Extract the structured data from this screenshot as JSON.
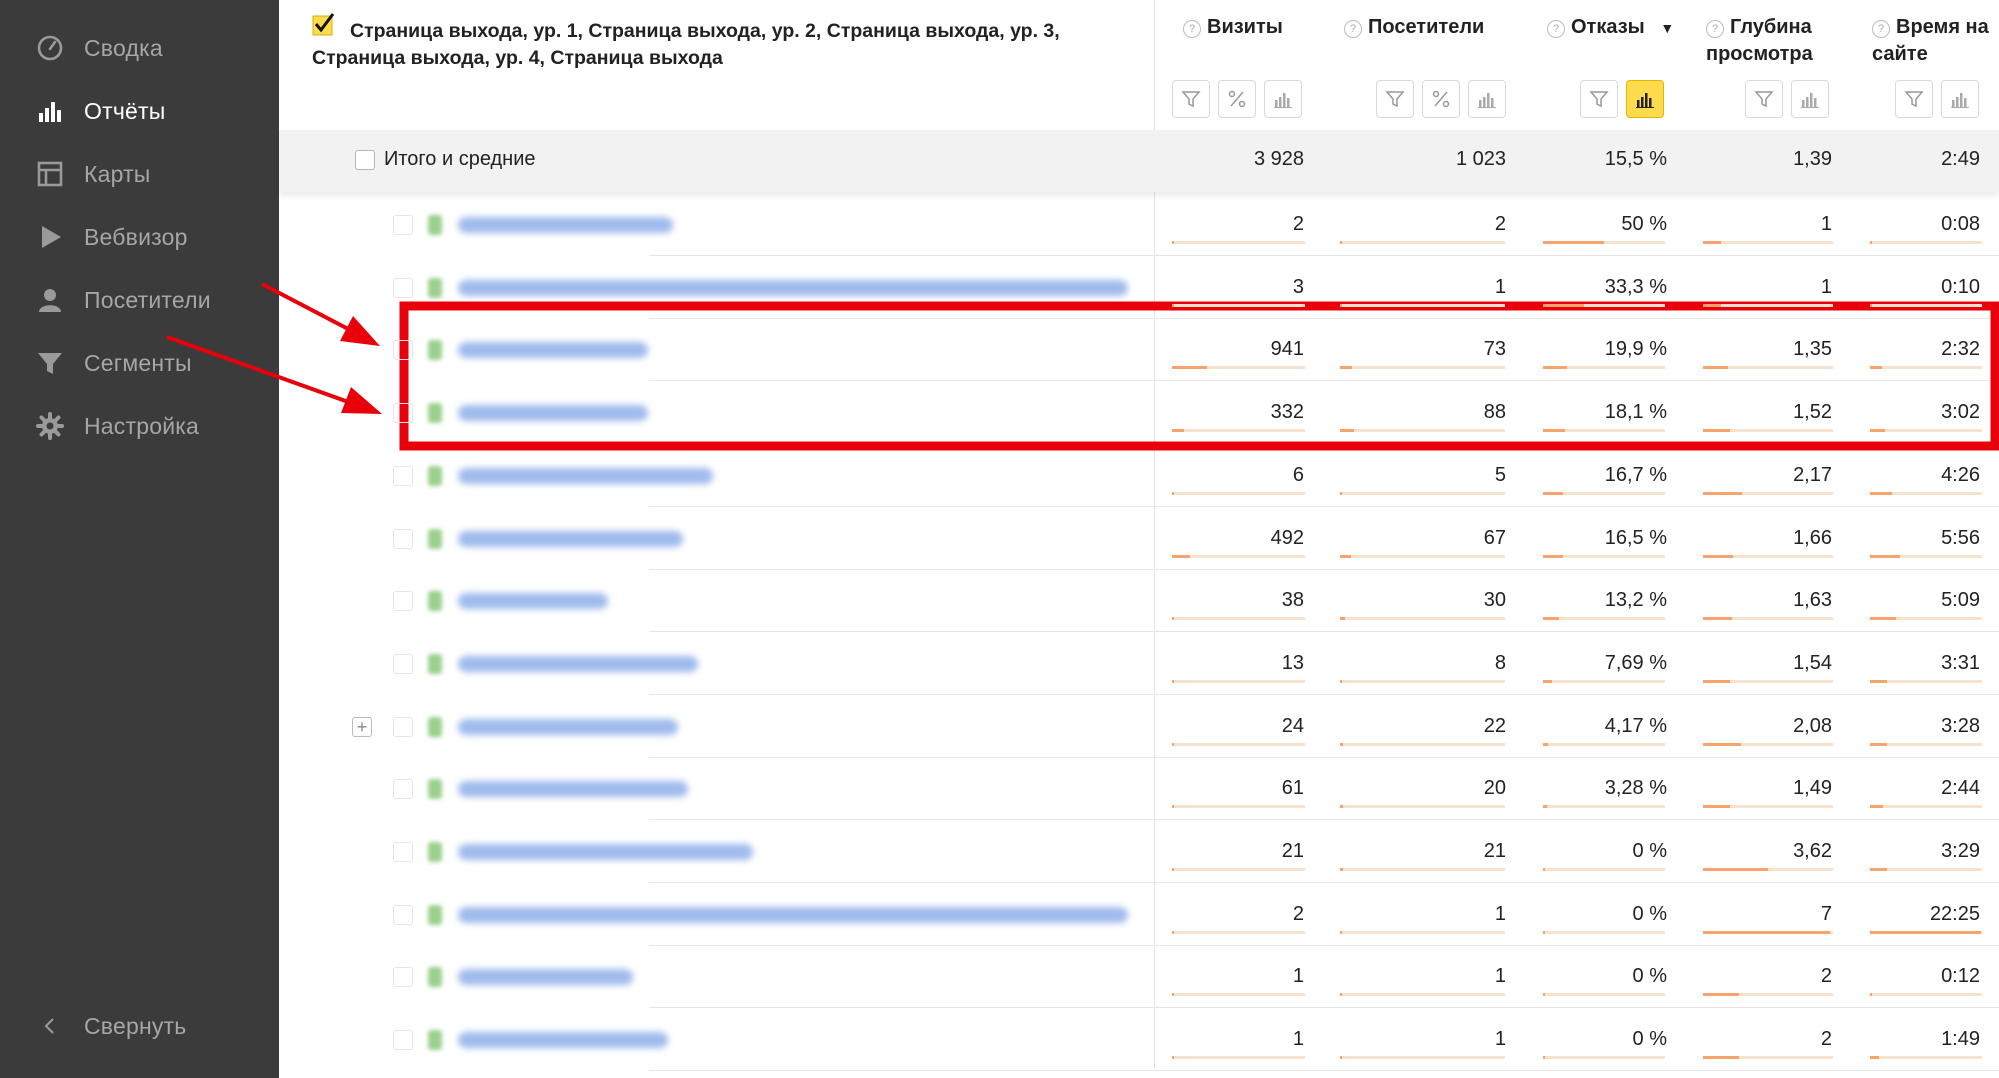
{
  "sidebar": {
    "items": [
      {
        "label": "Сводка",
        "icon": "dashboard-gauge-icon",
        "active": false
      },
      {
        "label": "Отчёты",
        "icon": "bar-chart-icon",
        "active": true
      },
      {
        "label": "Карты",
        "icon": "map-layout-icon",
        "active": false
      },
      {
        "label": "Вебвизор",
        "icon": "play-icon",
        "active": false
      },
      {
        "label": "Посетители",
        "icon": "person-icon",
        "active": false
      },
      {
        "label": "Сегменты",
        "icon": "funnel-icon",
        "active": false
      },
      {
        "label": "Настройка",
        "icon": "gear-icon",
        "active": false
      }
    ],
    "collapse_label": "Свернуть",
    "collapse_icon": "chevron-left-icon"
  },
  "header": {
    "dimension_label": "Страница выхода, ур. 1, Страница выхода, ур. 2, Страница выхода, ур. 3, Страница выхода, ур. 4, Страница выхода",
    "columns": [
      {
        "label": "Визиты",
        "tools": [
          "filter",
          "percent",
          "chart"
        ]
      },
      {
        "label": "Посетители",
        "tools": [
          "filter",
          "percent",
          "chart"
        ]
      },
      {
        "label": "Отказы",
        "sort": "▼",
        "tools": [
          "filter",
          "chart-active"
        ]
      },
      {
        "label": "Глубина просмотра",
        "tools": [
          "filter",
          "chart"
        ]
      },
      {
        "label": "Время на сайте",
        "tools": [
          "filter",
          "chart"
        ]
      }
    ]
  },
  "totals": {
    "label": "Итого и средние",
    "values": [
      "3 928",
      "1 023",
      "15,5 %",
      "1,39",
      "2:49"
    ]
  },
  "rows": [
    {
      "values": [
        "2",
        "2",
        "50 %",
        "1",
        "0:08"
      ],
      "bars": [
        0.002,
        0.002,
        0.5,
        0.14,
        0.006
      ],
      "url_width": 215,
      "expand": false
    },
    {
      "values": [
        "3",
        "1",
        "33,3 %",
        "1",
        "0:10"
      ],
      "bars": [
        0.003,
        0.001,
        0.333,
        0.14,
        0.007
      ],
      "url_width": 670,
      "expand": false
    },
    {
      "values": [
        "941",
        "73",
        "19,9 %",
        "1,35",
        "2:32"
      ],
      "bars": [
        0.26,
        0.07,
        0.199,
        0.19,
        0.11
      ],
      "url_width": 190,
      "expand": false
    },
    {
      "values": [
        "332",
        "88",
        "18,1 %",
        "1,52",
        "3:02"
      ],
      "bars": [
        0.09,
        0.085,
        0.181,
        0.21,
        0.135
      ],
      "url_width": 190,
      "expand": false
    },
    {
      "values": [
        "6",
        "5",
        "16,7 %",
        "2,17",
        "4:26"
      ],
      "bars": [
        0.006,
        0.005,
        0.167,
        0.3,
        0.2
      ],
      "url_width": 255,
      "expand": false
    },
    {
      "values": [
        "492",
        "67",
        "16,5 %",
        "1,66",
        "5:56"
      ],
      "bars": [
        0.135,
        0.065,
        0.165,
        0.23,
        0.265
      ],
      "url_width": 225,
      "expand": false
    },
    {
      "values": [
        "38",
        "30",
        "13,2 %",
        "1,63",
        "5:09"
      ],
      "bars": [
        0.01,
        0.03,
        0.132,
        0.225,
        0.23
      ],
      "url_width": 150,
      "expand": false
    },
    {
      "values": [
        "13",
        "8",
        "7,69 %",
        "1,54",
        "3:31"
      ],
      "bars": [
        0.004,
        0.008,
        0.077,
        0.21,
        0.155
      ],
      "url_width": 240,
      "expand": false
    },
    {
      "values": [
        "24",
        "22",
        "4,17 %",
        "2,08",
        "3:28"
      ],
      "bars": [
        0.007,
        0.021,
        0.042,
        0.29,
        0.153
      ],
      "url_width": 220,
      "expand": true
    },
    {
      "values": [
        "61",
        "20",
        "3,28 %",
        "1,49",
        "2:44"
      ],
      "bars": [
        0.017,
        0.019,
        0.033,
        0.205,
        0.12
      ],
      "url_width": 230,
      "expand": false
    },
    {
      "values": [
        "21",
        "21",
        "0 %",
        "3,62",
        "3:29"
      ],
      "bars": [
        0.006,
        0.02,
        0.0,
        0.5,
        0.154
      ],
      "url_width": 295,
      "expand": false
    },
    {
      "values": [
        "2",
        "1",
        "0 %",
        "7",
        "22:25"
      ],
      "bars": [
        0.002,
        0.001,
        0.0,
        0.98,
        0.99
      ],
      "url_width": 670,
      "expand": false
    },
    {
      "values": [
        "1",
        "1",
        "0 %",
        "2",
        "0:12"
      ],
      "bars": [
        0.001,
        0.001,
        0.0,
        0.28,
        0.009
      ],
      "url_width": 175,
      "expand": false
    },
    {
      "values": [
        "1",
        "1",
        "0 %",
        "2",
        "1:49"
      ],
      "bars": [
        0.001,
        0.001,
        0.0,
        0.28,
        0.08
      ],
      "url_width": 210,
      "expand": false
    }
  ],
  "colors": {
    "sidebar_bg": "#3b3b3b",
    "annotation_red": "#e8000b",
    "bar_fill": "#f5a46b",
    "bar_track": "#f7e2cf",
    "active_tool": "#ffdb4d",
    "check_yellow": "#ffdb4d"
  }
}
